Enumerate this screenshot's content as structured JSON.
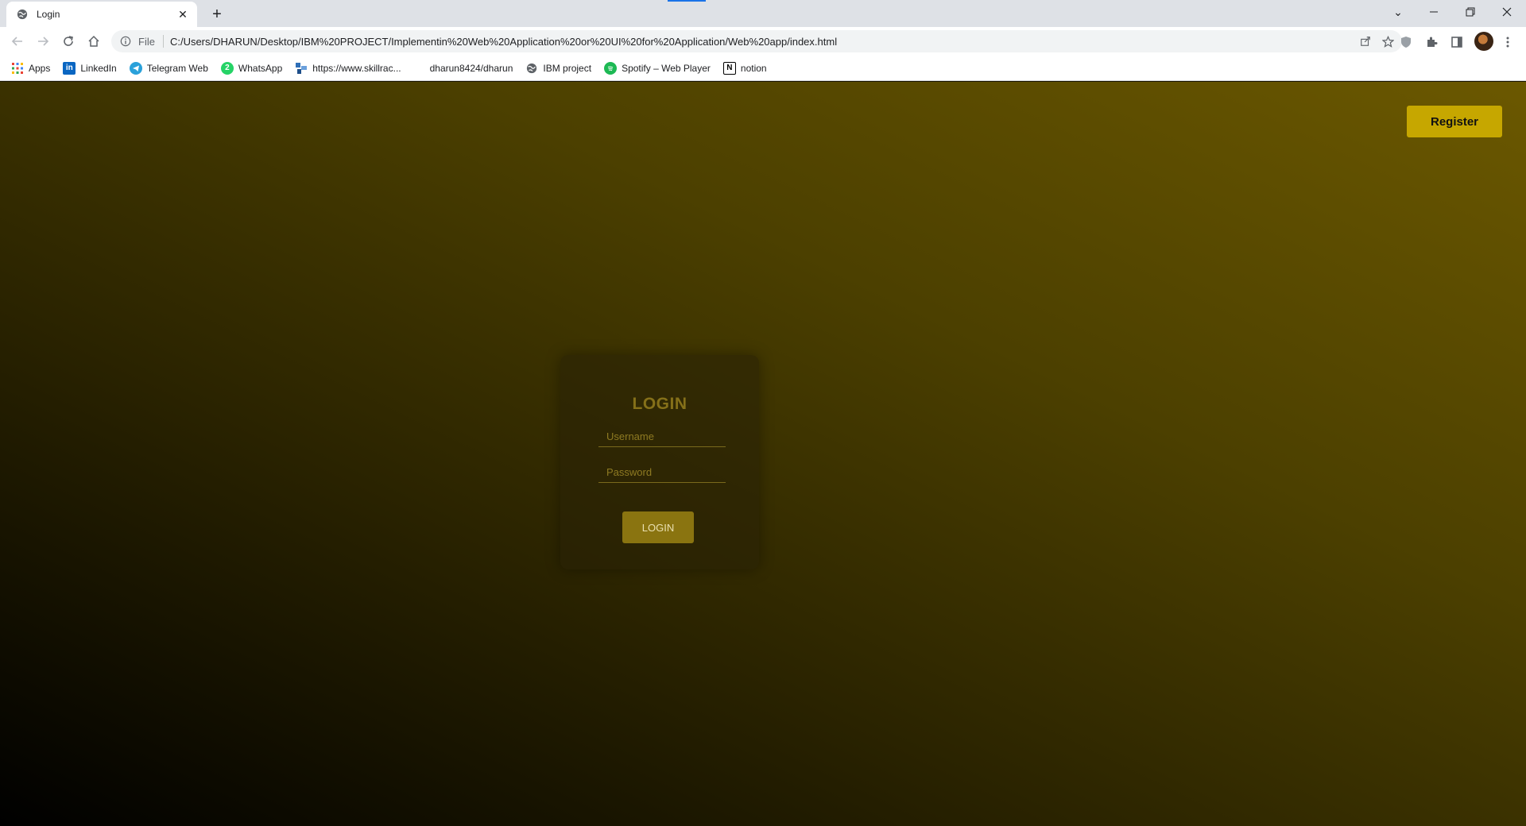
{
  "browser": {
    "tab": {
      "title": "Login"
    },
    "address_bar": {
      "scheme_label": "File",
      "url": "C:/Users/DHARUN/Desktop/IBM%20PROJECT/Implementin%20Web%20Application%20or%20UI%20for%20Application/Web%20app/index.html"
    },
    "bookmarks": [
      {
        "label": "Apps",
        "icon": "apps-grid-icon"
      },
      {
        "label": "LinkedIn",
        "icon": "linkedin-icon",
        "color": "#0a66c2"
      },
      {
        "label": "Telegram Web",
        "icon": "telegram-icon",
        "color": "#2aa1da"
      },
      {
        "label": "WhatsApp",
        "icon": "whatsapp-icon",
        "color": "#25d366"
      },
      {
        "label": "https://www.skillrac...",
        "icon": "skillrack-icon",
        "color": "#2f6fb8"
      },
      {
        "label": "dharun8424/dharun",
        "icon": "",
        "color": ""
      },
      {
        "label": "IBM project",
        "icon": "globe-icon",
        "color": "#5f6368"
      },
      {
        "label": "Spotify – Web Player",
        "icon": "spotify-icon",
        "color": "#1db954"
      },
      {
        "label": "notion",
        "icon": "notion-icon",
        "color": "#000000"
      }
    ]
  },
  "page": {
    "register_label": "Register",
    "login": {
      "title": "LOGIN",
      "username_placeholder": "Username",
      "password_placeholder": "Password",
      "button_label": "LOGIN"
    },
    "colors": {
      "accent": "#c6a700",
      "button": "#8a7410",
      "title": "#857019"
    }
  }
}
